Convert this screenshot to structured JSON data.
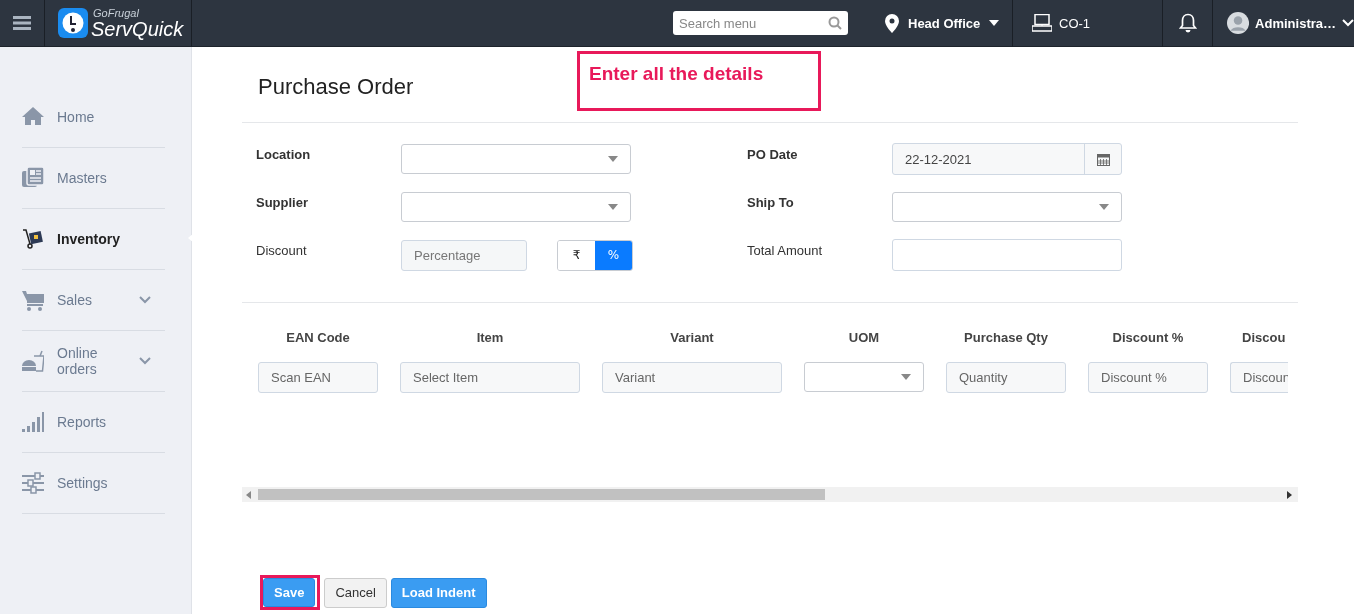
{
  "topbar": {
    "logo": {
      "brand": "GoFrugal",
      "product": "ServQuick"
    },
    "search": {
      "placeholder": "Search menu"
    },
    "location": "Head Office",
    "counter": "CO-1",
    "user": "Administra…"
  },
  "sidebar": {
    "items": [
      {
        "label": "Home",
        "selected": false,
        "submenu": false
      },
      {
        "label": "Masters",
        "selected": false,
        "submenu": false
      },
      {
        "label": "Inventory",
        "selected": true,
        "submenu": false
      },
      {
        "label": "Sales",
        "selected": false,
        "submenu": true
      },
      {
        "label": "Online orders",
        "selected": false,
        "submenu": true
      },
      {
        "label": "Reports",
        "selected": false,
        "submenu": false
      },
      {
        "label": "Settings",
        "selected": false,
        "submenu": false
      }
    ]
  },
  "page": {
    "title": "Purchase Order",
    "annotation": "Enter all the details",
    "form": [
      {
        "label": "Location",
        "required": true,
        "kind": "select"
      },
      {
        "label": "PO Date",
        "required": true,
        "kind": "date",
        "value": "22-12-2021"
      },
      {
        "label": "Supplier",
        "required": true,
        "kind": "select"
      },
      {
        "label": "Ship To",
        "required": true,
        "kind": "select"
      },
      {
        "label": "Discount",
        "required": false,
        "kind": "discount",
        "placeholder": "Percentage",
        "options": [
          {
            "label": "₹",
            "selected": false
          },
          {
            "label": "%",
            "selected": true
          }
        ]
      },
      {
        "label": "Total Amount",
        "required": false,
        "kind": "text"
      }
    ],
    "table": {
      "columns": [
        {
          "header": "EAN Code",
          "kind": "text",
          "placeholder": "Scan EAN"
        },
        {
          "header": "Item",
          "kind": "text",
          "placeholder": "Select Item"
        },
        {
          "header": "Variant",
          "kind": "text",
          "placeholder": "Variant"
        },
        {
          "header": "UOM",
          "kind": "select"
        },
        {
          "header": "Purchase Qty",
          "kind": "text",
          "placeholder": "Quantity"
        },
        {
          "header": "Discount %",
          "kind": "text",
          "placeholder": "Discount %"
        },
        {
          "header": "Discou",
          "kind": "text",
          "placeholder": "Discoun"
        }
      ]
    },
    "buttons": [
      {
        "label": "Save",
        "kind": "primary",
        "highlighted": true
      },
      {
        "label": "Cancel",
        "kind": "default",
        "highlighted": false
      },
      {
        "label": "Load Indent",
        "kind": "primary",
        "highlighted": false
      }
    ]
  }
}
